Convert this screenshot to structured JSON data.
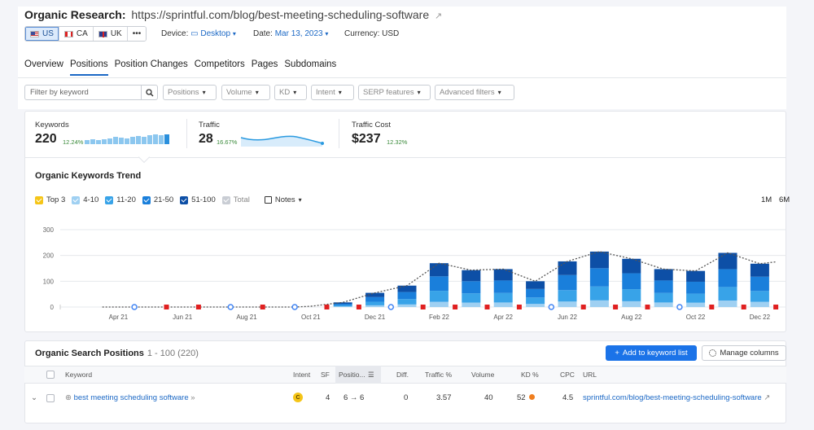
{
  "header": {
    "title_label": "Organic Research:",
    "title_url": "https://sprintful.com/blog/best-meeting-scheduling-software",
    "databases": [
      {
        "code": "US",
        "flag": "us",
        "active": true
      },
      {
        "code": "CA",
        "flag": "ca",
        "active": false
      },
      {
        "code": "UK",
        "flag": "uk",
        "active": false
      }
    ],
    "more_label": "•••",
    "device_label": "Device:",
    "device_value": "Desktop",
    "date_label": "Date:",
    "date_value": "Mar 13, 2023",
    "currency_label": "Currency: USD"
  },
  "tabs": [
    "Overview",
    "Positions",
    "Position Changes",
    "Competitors",
    "Pages",
    "Subdomains"
  ],
  "active_tab": "Positions",
  "filters": {
    "search_placeholder": "Filter by keyword",
    "buttons": [
      "Positions",
      "Volume",
      "KD",
      "Intent",
      "SERP features",
      "Advanced filters"
    ]
  },
  "summary": {
    "keywords": {
      "label": "Keywords",
      "value": "220",
      "pct": "12.24%"
    },
    "traffic": {
      "label": "Traffic",
      "value": "28",
      "pct": "16.67%"
    },
    "cost": {
      "label": "Traffic Cost",
      "value": "$237",
      "pct": "12.32%"
    }
  },
  "trend": {
    "title": "Organic Keywords Trend",
    "legend": [
      {
        "label": "Top 3",
        "color": "#f5c518"
      },
      {
        "label": "4-10",
        "color": "#9fd0f2"
      },
      {
        "label": "11-20",
        "color": "#38a3e8"
      },
      {
        "label": "21-50",
        "color": "#1a7fdb"
      },
      {
        "label": "51-100",
        "color": "#0d4fa6"
      },
      {
        "label": "Total",
        "color": "#c9cdd4"
      }
    ],
    "notes_label": "Notes",
    "ranges": [
      "1M",
      "6M"
    ]
  },
  "chart_data": {
    "type": "bar",
    "yticks": [
      0,
      100,
      200,
      300
    ],
    "ylim": [
      0,
      300
    ],
    "xlabels": [
      "Apr 21",
      "Jun 21",
      "Aug 21",
      "Oct 21",
      "Dec 21",
      "Feb 22",
      "Apr 22",
      "Jun 22",
      "Aug 22",
      "Oct 22",
      "Dec 22"
    ],
    "series_colors": [
      "#9fd0f2",
      "#38a3e8",
      "#1a7fdb",
      "#0d4fa6"
    ],
    "bars": [
      {
        "i": 16,
        "total": 18
      },
      {
        "i": 18,
        "total": 55
      },
      {
        "i": 20,
        "total": 83
      },
      {
        "i": 22,
        "total": 170
      },
      {
        "i": 24,
        "total": 143
      },
      {
        "i": 26,
        "total": 147
      },
      {
        "i": 28,
        "total": 100
      },
      {
        "i": 30,
        "total": 177
      },
      {
        "i": 32,
        "total": 215
      },
      {
        "i": 34,
        "total": 187
      },
      {
        "i": 36,
        "total": 147
      },
      {
        "i": 38,
        "total": 140
      },
      {
        "i": 40,
        "total": 210
      },
      {
        "i": 42,
        "total": 168
      }
    ],
    "trend_line": [
      [
        1,
        0
      ],
      [
        3,
        0
      ],
      [
        5,
        0
      ],
      [
        7,
        0
      ],
      [
        9,
        0
      ],
      [
        11,
        0
      ],
      [
        13,
        0
      ],
      [
        14,
        3
      ],
      [
        16,
        18
      ],
      [
        18,
        55
      ],
      [
        20,
        83
      ],
      [
        22,
        170
      ],
      [
        24,
        143
      ],
      [
        26,
        147
      ],
      [
        28,
        100
      ],
      [
        30,
        177
      ],
      [
        32,
        215
      ],
      [
        34,
        187
      ],
      [
        36,
        147
      ],
      [
        38,
        140
      ],
      [
        40,
        210
      ],
      [
        42,
        168
      ],
      [
        43,
        175
      ]
    ]
  },
  "table": {
    "title": "Organic Search Positions",
    "range": "1 - 100 (220)",
    "add_button": "Add to keyword list",
    "manage_button": "Manage columns",
    "headers": [
      "Keyword",
      "Intent",
      "SF",
      "Positio...",
      "Diff.",
      "Traffic %",
      "Volume",
      "KD %",
      "CPC",
      "URL"
    ],
    "rows": [
      {
        "keyword": "best meeting scheduling software",
        "intent": "C",
        "sf": "4",
        "position": "6 → 6",
        "diff": "0",
        "traffic_pct": "3.57",
        "volume": "40",
        "kd": "52",
        "cpc": "4.5",
        "url": "sprintful.com/blog/best-meeting-scheduling-software"
      }
    ]
  }
}
